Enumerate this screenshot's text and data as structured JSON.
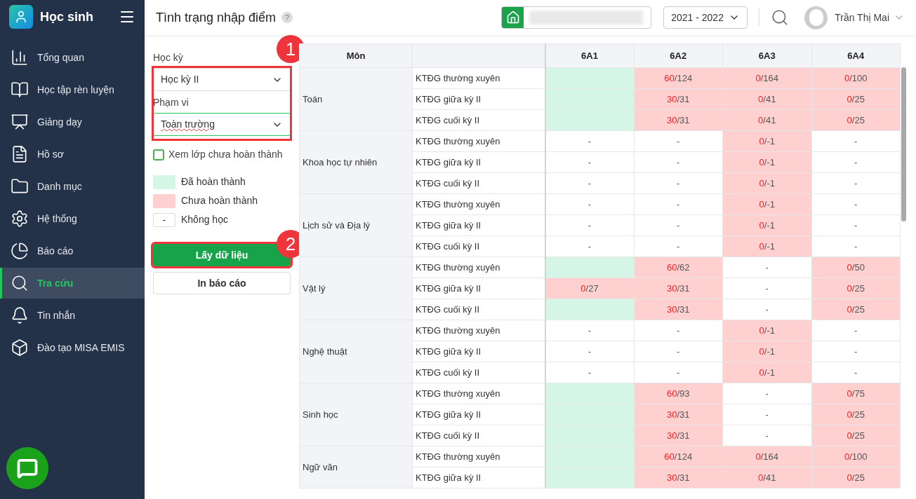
{
  "sidebar": {
    "app_name": "Học sinh",
    "items": [
      {
        "label": "Tổng quan",
        "selected": false
      },
      {
        "label": "Học tập rèn luyện",
        "selected": false
      },
      {
        "label": "Giảng dạy",
        "selected": false
      },
      {
        "label": "Hồ sơ",
        "selected": false
      },
      {
        "label": "Danh mục",
        "selected": false
      },
      {
        "label": "Hệ thống",
        "selected": false
      },
      {
        "label": "Báo cáo",
        "selected": false
      },
      {
        "label": "Tra cứu",
        "selected": true
      },
      {
        "label": "Tin nhắn",
        "selected": false
      },
      {
        "label": "Đào tạo MISA EMIS",
        "selected": false
      }
    ]
  },
  "header": {
    "title": "Tình trạng nhập điểm",
    "help": "?",
    "school_year": "2021 - 2022",
    "user_name": "Trần Thị Mai"
  },
  "filters": {
    "fields": [
      {
        "label": "Học kỳ",
        "value": "Học kỳ II",
        "focused": false
      },
      {
        "label": "Phạm vi",
        "value": "Toàn trường",
        "focused": true
      }
    ],
    "checkbox": {
      "label": "Xem lớp chưa hoàn thành",
      "checked": false
    },
    "legend": [
      {
        "kind": "done",
        "label": "Đã hoàn thành"
      },
      {
        "kind": "pending",
        "label": "Chưa hoàn thành"
      },
      {
        "kind": "none",
        "symbol": "-",
        "label": "Không học"
      }
    ],
    "buttons": [
      {
        "kind": "primary",
        "label": "Lấy dữ liệu"
      },
      {
        "kind": "secondary",
        "label": "In báo cáo"
      }
    ],
    "callouts": [
      {
        "number": "1"
      },
      {
        "number": "2"
      }
    ]
  },
  "table": {
    "subject_header": "Môn",
    "classes": [
      "6A1",
      "6A2",
      "6A3",
      "6A4"
    ],
    "groups": [
      {
        "subject": "Toán",
        "rows": [
          {
            "test": "KTĐG thường xuyên",
            "cells": [
              {
                "kind": "done"
              },
              {
                "kind": "pending",
                "count": "60",
                "rest": "/124"
              },
              {
                "kind": "pending",
                "count": "0",
                "rest": "/164"
              },
              {
                "kind": "pending",
                "count": "0",
                "rest": "/100"
              }
            ]
          },
          {
            "test": "KTĐG giữa kỳ II",
            "cells": [
              {
                "kind": "done"
              },
              {
                "kind": "pending",
                "count": "30",
                "rest": "/31"
              },
              {
                "kind": "pending",
                "count": "0",
                "rest": "/41"
              },
              {
                "kind": "pending",
                "count": "0",
                "rest": "/25"
              }
            ]
          },
          {
            "test": "KTĐG cuối kỳ II",
            "cells": [
              {
                "kind": "done"
              },
              {
                "kind": "pending",
                "count": "30",
                "rest": "/31"
              },
              {
                "kind": "pending",
                "count": "0",
                "rest": "/41"
              },
              {
                "kind": "pending",
                "count": "0",
                "rest": "/25"
              }
            ]
          }
        ]
      },
      {
        "subject": "Khoa học tự nhiên",
        "rows": [
          {
            "test": "KTĐG thường xuyên",
            "cells": [
              {
                "kind": "none",
                "text": "-"
              },
              {
                "kind": "none",
                "text": "-"
              },
              {
                "kind": "pending",
                "count": "0",
                "rest": "/-1"
              },
              {
                "kind": "none",
                "text": "-"
              }
            ]
          },
          {
            "test": "KTĐG giữa kỳ II",
            "cells": [
              {
                "kind": "none",
                "text": "-"
              },
              {
                "kind": "none",
                "text": "-"
              },
              {
                "kind": "pending",
                "count": "0",
                "rest": "/-1"
              },
              {
                "kind": "none",
                "text": "-"
              }
            ]
          },
          {
            "test": "KTĐG cuối kỳ II",
            "cells": [
              {
                "kind": "none",
                "text": "-"
              },
              {
                "kind": "none",
                "text": "-"
              },
              {
                "kind": "pending",
                "count": "0",
                "rest": "/-1"
              },
              {
                "kind": "none",
                "text": "-"
              }
            ]
          }
        ]
      },
      {
        "subject": "Lịch sử và Địa lý",
        "rows": [
          {
            "test": "KTĐG thường xuyên",
            "cells": [
              {
                "kind": "none",
                "text": "-"
              },
              {
                "kind": "none",
                "text": "-"
              },
              {
                "kind": "pending",
                "count": "0",
                "rest": "/-1"
              },
              {
                "kind": "none",
                "text": "-"
              }
            ]
          },
          {
            "test": "KTĐG giữa kỳ II",
            "cells": [
              {
                "kind": "none",
                "text": "-"
              },
              {
                "kind": "none",
                "text": "-"
              },
              {
                "kind": "pending",
                "count": "0",
                "rest": "/-1"
              },
              {
                "kind": "none",
                "text": "-"
              }
            ]
          },
          {
            "test": "KTĐG cuối kỳ II",
            "cells": [
              {
                "kind": "none",
                "text": "-"
              },
              {
                "kind": "none",
                "text": "-"
              },
              {
                "kind": "pending",
                "count": "0",
                "rest": "/-1"
              },
              {
                "kind": "none",
                "text": "-"
              }
            ]
          }
        ]
      },
      {
        "subject": "Vật lý",
        "rows": [
          {
            "test": "KTĐG thường xuyên",
            "cells": [
              {
                "kind": "done"
              },
              {
                "kind": "pending",
                "count": "60",
                "rest": "/62"
              },
              {
                "kind": "none",
                "text": "-"
              },
              {
                "kind": "pending",
                "count": "0",
                "rest": "/50"
              }
            ]
          },
          {
            "test": "KTĐG giữa kỳ II",
            "cells": [
              {
                "kind": "pending",
                "count": "0",
                "rest": "/27"
              },
              {
                "kind": "pending",
                "count": "30",
                "rest": "/31"
              },
              {
                "kind": "none",
                "text": "-"
              },
              {
                "kind": "pending",
                "count": "0",
                "rest": "/25"
              }
            ]
          },
          {
            "test": "KTĐG cuối kỳ II",
            "cells": [
              {
                "kind": "done"
              },
              {
                "kind": "pending",
                "count": "30",
                "rest": "/31"
              },
              {
                "kind": "none",
                "text": "-"
              },
              {
                "kind": "pending",
                "count": "0",
                "rest": "/25"
              }
            ]
          }
        ]
      },
      {
        "subject": "Nghệ thuật",
        "rows": [
          {
            "test": "KTĐG thường xuyên",
            "cells": [
              {
                "kind": "none",
                "text": "-"
              },
              {
                "kind": "none",
                "text": "-"
              },
              {
                "kind": "pending",
                "count": "0",
                "rest": "/-1"
              },
              {
                "kind": "none",
                "text": "-"
              }
            ]
          },
          {
            "test": "KTĐG giữa kỳ II",
            "cells": [
              {
                "kind": "none",
                "text": "-"
              },
              {
                "kind": "none",
                "text": "-"
              },
              {
                "kind": "pending",
                "count": "0",
                "rest": "/-1"
              },
              {
                "kind": "none",
                "text": "-"
              }
            ]
          },
          {
            "test": "KTĐG cuối kỳ II",
            "cells": [
              {
                "kind": "none",
                "text": "-"
              },
              {
                "kind": "none",
                "text": "-"
              },
              {
                "kind": "pending",
                "count": "0",
                "rest": "/-1"
              },
              {
                "kind": "none",
                "text": "-"
              }
            ]
          }
        ]
      },
      {
        "subject": "Sinh học",
        "rows": [
          {
            "test": "KTĐG thường xuyên",
            "cells": [
              {
                "kind": "done"
              },
              {
                "kind": "pending",
                "count": "60",
                "rest": "/93"
              },
              {
                "kind": "none",
                "text": "-"
              },
              {
                "kind": "pending",
                "count": "0",
                "rest": "/75"
              }
            ]
          },
          {
            "test": "KTĐG giữa kỳ II",
            "cells": [
              {
                "kind": "done"
              },
              {
                "kind": "pending",
                "count": "30",
                "rest": "/31"
              },
              {
                "kind": "none",
                "text": "-"
              },
              {
                "kind": "pending",
                "count": "0",
                "rest": "/25"
              }
            ]
          },
          {
            "test": "KTĐG cuối kỳ II",
            "cells": [
              {
                "kind": "done"
              },
              {
                "kind": "pending",
                "count": "30",
                "rest": "/31"
              },
              {
                "kind": "none",
                "text": "-"
              },
              {
                "kind": "pending",
                "count": "0",
                "rest": "/25"
              }
            ]
          }
        ]
      },
      {
        "subject": "Ngữ văn",
        "rows": [
          {
            "test": "KTĐG thường xuyên",
            "cells": [
              {
                "kind": "done"
              },
              {
                "kind": "pending",
                "count": "60",
                "rest": "/124"
              },
              {
                "kind": "pending",
                "count": "0",
                "rest": "/164"
              },
              {
                "kind": "pending",
                "count": "0",
                "rest": "/100"
              }
            ]
          },
          {
            "test": "KTĐG giữa kỳ II",
            "cells": [
              {
                "kind": "done"
              },
              {
                "kind": "pending",
                "count": "30",
                "rest": "/31"
              },
              {
                "kind": "pending",
                "count": "0",
                "rest": "/41"
              },
              {
                "kind": "pending",
                "count": "0",
                "rest": "/25"
              }
            ]
          }
        ]
      }
    ]
  }
}
